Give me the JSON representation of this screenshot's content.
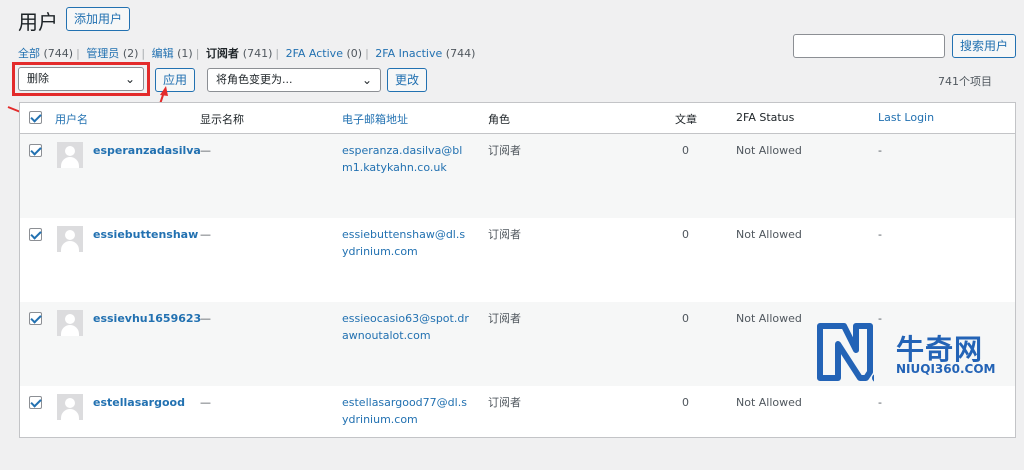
{
  "header": {
    "title": "用户",
    "add_button": "添加用户"
  },
  "filters": [
    {
      "label": "全部",
      "count": "(744)",
      "current": false
    },
    {
      "label": "管理员",
      "count": "(2)",
      "current": false
    },
    {
      "label": "编辑",
      "count": "(1)",
      "current": false
    },
    {
      "label": "订阅者",
      "count": "(741)",
      "current": true
    },
    {
      "label": "2FA Active",
      "count": "(0)",
      "current": false
    },
    {
      "label": "2FA Inactive",
      "count": "(744)",
      "current": false
    }
  ],
  "search": {
    "value": "",
    "button": "搜索用户"
  },
  "bulk": {
    "selected": "删除",
    "apply": "应用"
  },
  "role_change": {
    "selected": "将角色变更为...",
    "button": "更改"
  },
  "item_count": "741个项目",
  "columns": {
    "username": "用户名",
    "display_name": "显示名称",
    "email": "电子邮箱地址",
    "role": "角色",
    "posts": "文章",
    "twofa": "2FA Status",
    "last_login": "Last Login"
  },
  "rows": [
    {
      "username": "esperanzadasilva",
      "display_name": "—",
      "email": "esperanza.dasilva@blm1.katykahn.co.uk",
      "role": "订阅者",
      "posts": "0",
      "twofa": "Not Allowed",
      "last_login": "-",
      "checked": true
    },
    {
      "username": "essiebuttenshaw",
      "display_name": "—",
      "email": "essiebuttenshaw@dl.sydrinium.com",
      "role": "订阅者",
      "posts": "0",
      "twofa": "Not Allowed",
      "last_login": "-",
      "checked": true
    },
    {
      "username": "essievhu1659623",
      "display_name": "—",
      "email": "essieocasio63@spot.drawnoutalot.com",
      "role": "订阅者",
      "posts": "0",
      "twofa": "Not Allowed",
      "last_login": "-",
      "checked": true
    },
    {
      "username": "estellasargood",
      "display_name": "—",
      "email": "estellasargood77@dl.sydrinium.com",
      "role": "订阅者",
      "posts": "0",
      "twofa": "Not Allowed",
      "last_login": "-",
      "checked": true
    }
  ],
  "watermark": {
    "text": "牛奇网",
    "sub": "NIUQI360.COM"
  },
  "colors": {
    "accent": "#2271b1",
    "highlight": "#e32b2b",
    "logo": "#2363b6"
  }
}
